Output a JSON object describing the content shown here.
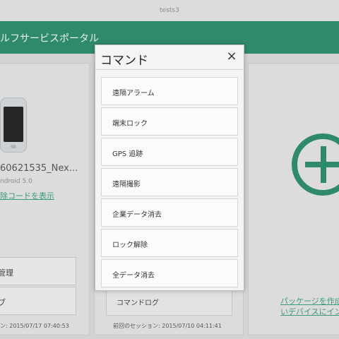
{
  "window": {
    "title": "tests3"
  },
  "header": {
    "title": "ルフサービスポータル"
  },
  "device": {
    "name": "60621535_Nex...",
    "os": "ndroid 5.0",
    "unlock_link": "除コードを表示",
    "buttons": [
      "管理",
      "ブ"
    ],
    "session": "ン: 2015/07/17 07:40:53"
  },
  "middle": {
    "command_log": "コマンドログ",
    "session": "前回のセッション: 2015/07/10 04:11:41"
  },
  "add_card": {
    "links": [
      "パッケージを作成",
      "いデバイスにイン"
    ],
    "accent": "#2f8a6b"
  },
  "modal": {
    "title": "コマンド",
    "close": "×",
    "commands": [
      "遠隔アラーム",
      "端末ロック",
      "GPS 追跡",
      "遠隔撮影",
      "企業データ消去",
      "ロック解除",
      "全データ消去"
    ]
  }
}
